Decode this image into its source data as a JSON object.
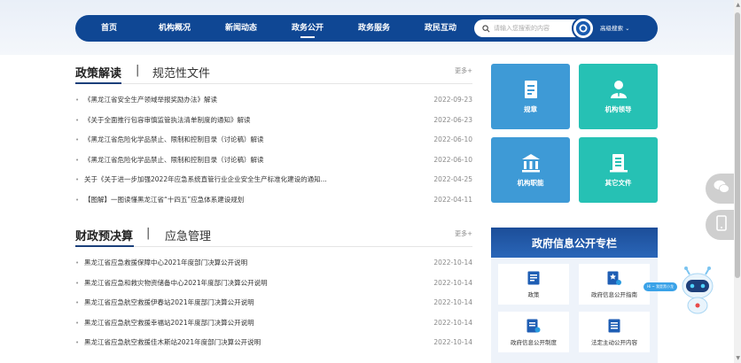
{
  "nav": {
    "items": [
      {
        "label": "首页",
        "active": false
      },
      {
        "label": "机构概况",
        "active": false
      },
      {
        "label": "新闻动态",
        "active": false
      },
      {
        "label": "政务公开",
        "active": true
      },
      {
        "label": "政务服务",
        "active": false
      },
      {
        "label": "政民互动",
        "active": false
      }
    ],
    "search_placeholder": "请输入您搜索的内容",
    "advanced_search": "高级搜索 ⌄",
    "bar_color": "#0f4794"
  },
  "policy": {
    "tab_active": "政策解读",
    "separator": "|",
    "tab_inactive": "规范性文件",
    "more": "更多+",
    "items": [
      {
        "title": "《黑龙江省安全生产领域举报奖励办法》解读",
        "date": "2022-09-23"
      },
      {
        "title": "《关于全面推行包容审慎监管执法清单制度的通知》解读",
        "date": "2022-06-23"
      },
      {
        "title": "《黑龙江省危险化学品禁止、限制和控制目录（讨论稿）解读",
        "date": "2022-06-10"
      },
      {
        "title": "《黑龙江省危险化学品禁止、限制和控制目录（讨论稿）解读",
        "date": "2022-06-10"
      },
      {
        "title": "关于《关于进一步加强2022年应急系统直管行业企业安全生产标准化建设的通知...",
        "date": "2022-04-25"
      },
      {
        "title": "【图解】一图读懂黑龙江省“十四五”应急体系建设规划",
        "date": "2022-04-11"
      }
    ]
  },
  "finance": {
    "tab_active": "财政预决算",
    "separator": "|",
    "tab_inactive": "应急管理",
    "more": "更多+",
    "items": [
      {
        "title": "黑龙江省应急救援保障中心2021年度部门决算公开说明",
        "date": "2022-10-14"
      },
      {
        "title": "黑龙江省应急和救灾物资储备中心2021年度部门决算公开说明",
        "date": "2022-10-14"
      },
      {
        "title": "黑龙江省应急航空救援伊春站2021年度部门决算公开说明",
        "date": "2022-10-14"
      },
      {
        "title": "黑龙江省应急航空救援幸福站2021年度部门决算公开说明",
        "date": "2022-10-14"
      },
      {
        "title": "黑龙江省应急航空救援佳木斯站2021年度部门决算公开说明",
        "date": "2022-10-14"
      }
    ]
  },
  "tiles": [
    {
      "label": "规章",
      "icon": "document-icon",
      "color": "#3e9ad6"
    },
    {
      "label": "机构领导",
      "icon": "person-icon",
      "color": "#26c1b4"
    },
    {
      "label": "机构职能",
      "icon": "institution-icon",
      "color": "#3e9ad6"
    },
    {
      "label": "其它文件",
      "icon": "files-icon",
      "color": "#26c1b4"
    }
  ],
  "info_panel": {
    "title": "政府信息公开专栏",
    "cards": [
      {
        "label": "政策",
        "icon": "policy-icon"
      },
      {
        "label": "政府信息公开指南",
        "icon": "guide-icon"
      },
      {
        "label": "政府信息公开制度",
        "icon": "system-icon"
      },
      {
        "label": "法定主动公开内容",
        "icon": "content-icon"
      }
    ]
  },
  "float": {
    "robot_badge": "Hi ~ 我是黑小龙"
  }
}
